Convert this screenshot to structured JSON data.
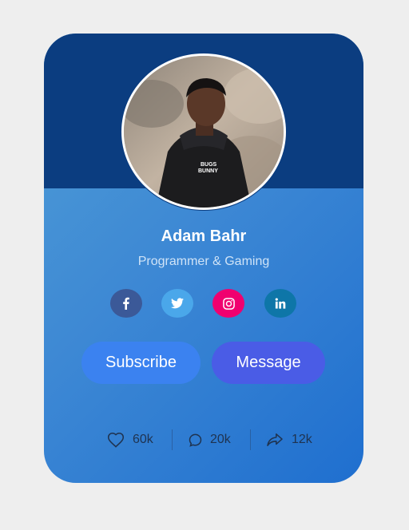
{
  "profile": {
    "name": "Adam Bahr",
    "role": "Programmer & Gaming",
    "shirt_text_line1": "BUGS",
    "shirt_text_line2": "BUNNY"
  },
  "social": [
    {
      "name": "facebook",
      "icon": "facebook-icon",
      "color": "#3b5998"
    },
    {
      "name": "twitter",
      "icon": "twitter-icon",
      "color": "#4aa7ea"
    },
    {
      "name": "instagram",
      "icon": "instagram-icon",
      "color": "#f0006f"
    },
    {
      "name": "linkedin",
      "icon": "linkedin-icon",
      "color": "#0e76a8"
    }
  ],
  "buttons": {
    "subscribe_label": "Subscribe",
    "message_label": "Message"
  },
  "stats": {
    "likes": "60k",
    "comments": "20k",
    "shares": "12k"
  },
  "colors": {
    "background": "#eeeeee",
    "header": "#0b3d80",
    "subscribe": "#3b82f0",
    "message": "#4a5ce6"
  }
}
